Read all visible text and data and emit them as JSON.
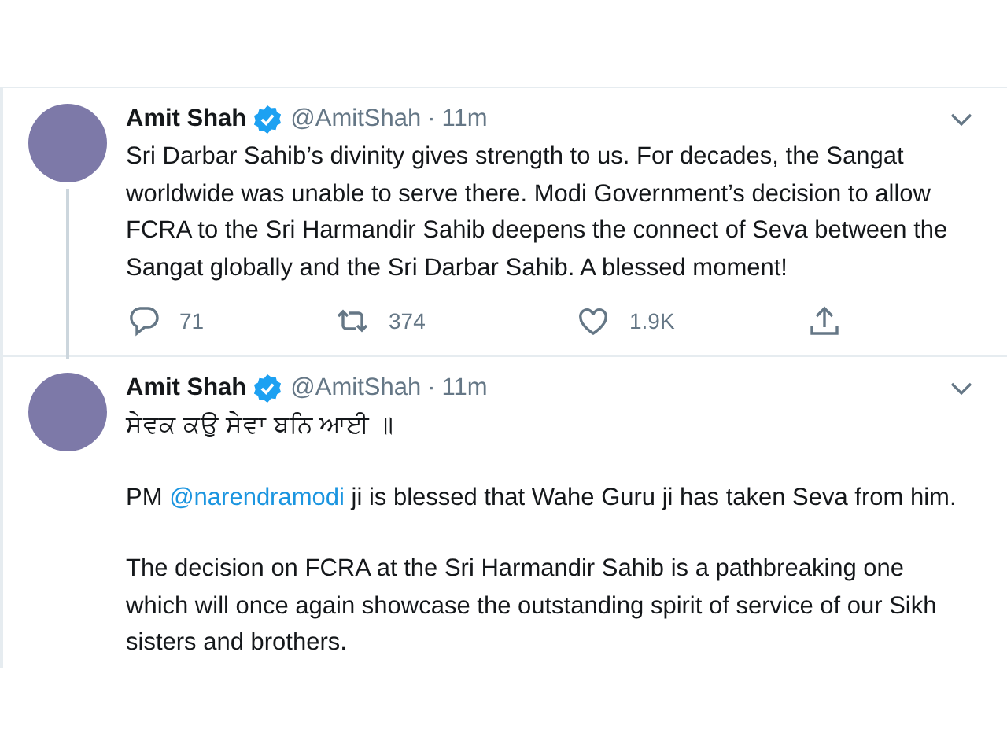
{
  "tweets": [
    {
      "name": "Amit Shah",
      "verified": true,
      "handle": "@AmitShah",
      "separator": "·",
      "time": "11m",
      "thread_line": true,
      "paragraphs": [
        [
          {
            "kind": "text",
            "text": "Sri Darbar Sahib’s divinity gives strength to us. For decades, the Sangat worldwide was unable to serve there. Modi Government’s decision to allow FCRA to the Sri Harmandir Sahib deepens the connect of Seva between the Sangat globally and the Sri Darbar Sahib. A blessed moment!"
          }
        ]
      ],
      "actions": [
        {
          "kind": "reply",
          "count": "71"
        },
        {
          "kind": "retweet",
          "count": "374"
        },
        {
          "kind": "like",
          "count": "1.9K"
        },
        {
          "kind": "share"
        }
      ]
    },
    {
      "name": "Amit Shah",
      "verified": true,
      "handle": "@AmitShah",
      "separator": "·",
      "time": "11m",
      "thread_line": false,
      "paragraphs": [
        [
          {
            "kind": "text",
            "text": "ਸੇਵਕ ਕਉ ਸੇਵਾ ਬਨਿ ਆਈ ॥"
          }
        ],
        [
          {
            "kind": "text",
            "text": "PM "
          },
          {
            "kind": "mention",
            "text": "@narendramodi"
          },
          {
            "kind": "text",
            "text": " ji is blessed that Wahe Guru ji has taken Seva from him."
          }
        ],
        [
          {
            "kind": "text",
            "text": "The decision on FCRA at the Sri Harmandir Sahib is a pathbreaking one which will once again showcase the outstanding spirit of service of our Sikh sisters and brothers."
          }
        ]
      ]
    }
  ]
}
